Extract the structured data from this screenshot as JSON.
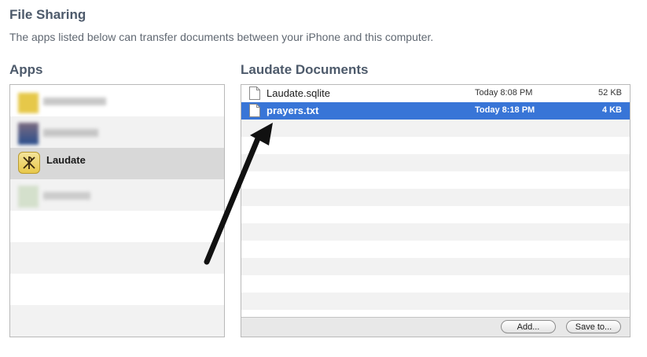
{
  "header": {
    "title": "File Sharing",
    "subtitle": "The apps listed below can transfer documents between your iPhone and this computer."
  },
  "apps": {
    "heading": "Apps",
    "items": [
      {
        "label": "",
        "obscured": true
      },
      {
        "label": "",
        "obscured": true
      },
      {
        "label": "Laudate",
        "selected": true,
        "icon": "chi-rho-icon"
      },
      {
        "label": "",
        "obscured": true
      }
    ]
  },
  "documents": {
    "heading": "Laudate Documents",
    "files": [
      {
        "name": "Laudate.sqlite",
        "date": "Today 8:08 PM",
        "size": "52 KB",
        "selected": false
      },
      {
        "name": "prayers.txt",
        "date": "Today 8:18 PM",
        "size": "4 KB",
        "selected": true
      }
    ],
    "add_label": "Add...",
    "save_label": "Save to..."
  },
  "colors": {
    "selection": "#3875d7",
    "heading": "#4d5a6b",
    "stripe": "#f2f2f2"
  }
}
